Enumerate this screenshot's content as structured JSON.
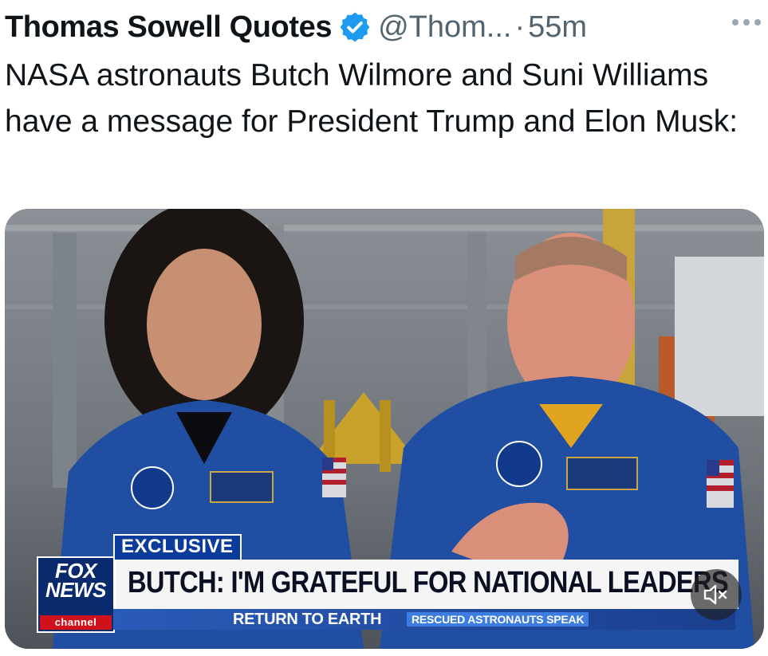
{
  "post": {
    "display_name": "Thomas Sowell Quotes",
    "handle": "@Thom...",
    "separator": "·",
    "time": "55m",
    "text": "NASA astronauts Butch Wilmore and Suni Williams have a message for President Trump and Elon Musk:"
  },
  "video": {
    "network_logo": "FOX NEWS",
    "network_channel": "channel",
    "exclusive_label": "EXCLUSIVE",
    "headline": "BUTCH: I'M GRATEFUL FOR NATIONAL LEADERS",
    "ticker_main": "RETURN TO EARTH",
    "ticker_sub": "RESCUED ASTRONAUTS SPEAK"
  },
  "icons": {
    "verified": "verified-badge-icon",
    "more": "more-options-icon",
    "mute": "muted-speaker-icon"
  },
  "colors": {
    "verified_blue": "#1d9bf0",
    "secondary_text": "#536471",
    "fox_blue": "#0a2a6e",
    "fox_red": "#d0101a",
    "flight_suit_blue": "#1f4ea3"
  }
}
